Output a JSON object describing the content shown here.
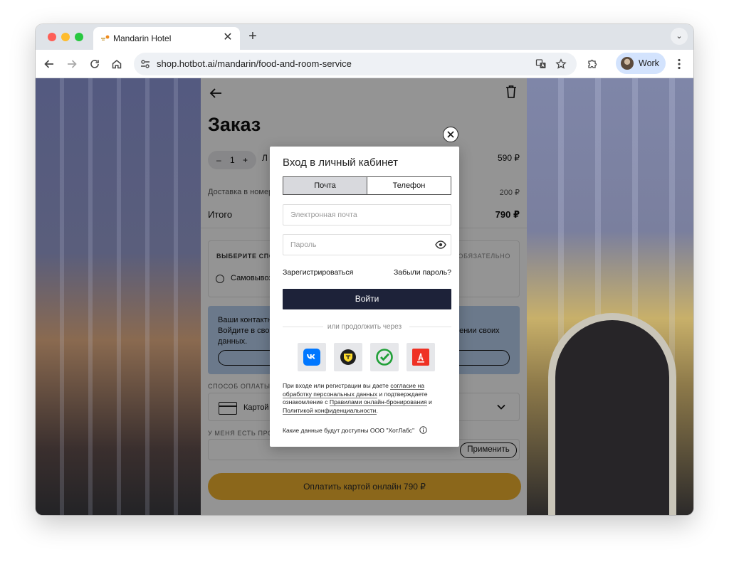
{
  "browser": {
    "tab_title": "Mandarin Hotel",
    "tab_close": "✕",
    "new_tab": "+",
    "tab_menu": "⌄",
    "url": "shop.hotbot.ai/mandarin/food-and-room-service",
    "profile_name": "Work",
    "accent": "#d3e3fd"
  },
  "page": {
    "title": "Заказ",
    "qty_minus": "–",
    "qty_value": "1",
    "qty_plus": "+",
    "item_letter": "Л",
    "item_price": "590 ₽",
    "delivery_label": "Доставка в номер",
    "delivery_price": "200 ₽",
    "total_label": "Итого",
    "total_value": "790 ₽",
    "method_heading": "ВЫБЕРИТЕ СПОСОБ",
    "method_required": "ОБЯЗАТЕЛЬНО",
    "pickup_label": "Самовывоз",
    "contact_line1": "Ваши контактные",
    "contact_line2": "Войдите в свой",
    "contact_line3": "данных.",
    "contact_right": "нении своих",
    "payment_heading": "СПОСОБ ОПЛАТЫ",
    "payment_value": "Картой",
    "promo_heading": "У МЕНЯ ЕСТЬ ПРОМ",
    "apply_label": "Применить",
    "pay_button": "Оплатить картой онлайн 790 ₽",
    "pay_color": "#f0b230"
  },
  "modal": {
    "title": "Вход в личный кабинет",
    "tab_email": "Почта",
    "tab_phone": "Телефон",
    "email_placeholder": "Электронная почта",
    "password_placeholder": "Пароль",
    "register_link": "Зарегистрироваться",
    "forgot_link": "Забыли пароль?",
    "login_button": "Войти",
    "login_color": "#1d2239",
    "or_text": "или продолжить через",
    "social": [
      {
        "name": "vk",
        "label": "VK",
        "color": "#0077ff"
      },
      {
        "name": "tbank",
        "label": "T",
        "color": "#ffdd2d"
      },
      {
        "name": "sber",
        "label": "✓",
        "color": "#21a038"
      },
      {
        "name": "alfa",
        "label": "A",
        "color": "#ef3124"
      }
    ],
    "legal_1": "При входе или регистрации вы даете ",
    "legal_link_1": "согласие на обработку персональных данных",
    "legal_2": " и подтверждаете ознакомление с ",
    "legal_link_2": "Правилами онлайн-бронирования",
    "legal_3": " и ",
    "legal_link_3": "Политикой конфиденциальности",
    "legal_4": ".",
    "data_note": "Какие данные будут доступны ООО \"ХотЛабс\""
  }
}
